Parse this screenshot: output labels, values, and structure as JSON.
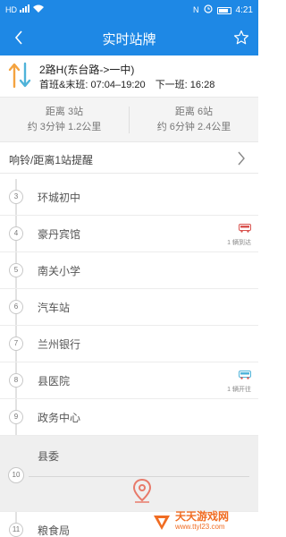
{
  "status_bar": {
    "left_icons": [
      "hd-icon",
      "signal-icon",
      "wifi-icon"
    ],
    "right_icons": [
      "nfc-icon",
      "alarm-icon",
      "battery-icon"
    ],
    "time": "4:21"
  },
  "header": {
    "title": "实时站牌"
  },
  "route": {
    "name": "2路H(东台路->一中)",
    "first_last_label": "首班&末班: 07:04–19:20",
    "next_label": "下一班: 16:28"
  },
  "distances": [
    {
      "stations": "距离 3站",
      "eta": "约 3分钟 1.2公里"
    },
    {
      "stations": "距离 6站",
      "eta": "约 6分钟 2.4公里"
    }
  ],
  "reminder": {
    "label": "响铃/距离1站提醒"
  },
  "stops": [
    {
      "num": "3",
      "name": "环城初中",
      "bus": ""
    },
    {
      "num": "4",
      "name": "豪丹宾馆",
      "bus": "1 辆到达"
    },
    {
      "num": "5",
      "name": "南关小学",
      "bus": ""
    },
    {
      "num": "6",
      "name": "汽车站",
      "bus": ""
    },
    {
      "num": "7",
      "name": "兰州银行",
      "bus": ""
    },
    {
      "num": "8",
      "name": "县医院",
      "bus": "1 辆开往"
    },
    {
      "num": "9",
      "name": "政务中心",
      "bus": ""
    },
    {
      "num": "10",
      "name": "县委",
      "bus": ""
    },
    {
      "num": "11",
      "name": "粮食局",
      "bus": ""
    }
  ],
  "watermark": {
    "title": "天天游戏网",
    "url": "www.ttyl23.com"
  },
  "colors": {
    "primary": "#1e88e5",
    "route_icon_orange": "#f4a340",
    "route_icon_blue": "#4fb3d9",
    "pin": "#e87a6a",
    "bus_icon": "#d9534f"
  }
}
